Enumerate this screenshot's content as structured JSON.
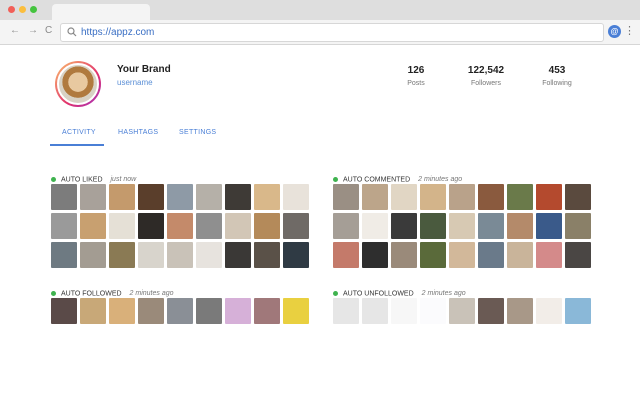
{
  "browser": {
    "url": "https://appz.com",
    "traffic_lights": [
      "#f25f58",
      "#fbbe3d",
      "#45c43f"
    ],
    "back_glyph": "←",
    "forward_glyph": "→",
    "reload_glyph": "C",
    "extension_badge": "@",
    "menu_glyph": "⋮"
  },
  "profile": {
    "brand": "Your Brand",
    "username": "username",
    "stats": [
      {
        "value": "126",
        "label": "Posts"
      },
      {
        "value": "122,542",
        "label": "Followers"
      },
      {
        "value": "453",
        "label": "Following"
      }
    ]
  },
  "tabs": [
    {
      "label": "ACTIVITY",
      "active": true
    },
    {
      "label": "HASHTAGS",
      "active": false
    },
    {
      "label": "SETTINGS",
      "active": false
    }
  ],
  "sections": {
    "auto_liked": {
      "title": "AUTO LIKED",
      "time": "just now",
      "thumbs": [
        "#7c7c7c",
        "#a8a19a",
        "#c49a6c",
        "#5a3e2b",
        "#8e9aa6",
        "#b5b0a8",
        "#3e3a36",
        "#d9b88a",
        "#e8e2da",
        "#9a9a9a",
        "#c8a070",
        "#e5e0d6",
        "#2e2a27",
        "#c48a6a",
        "#8f8f8f",
        "#d2c6b6",
        "#b48a5a",
        "#6f6a66",
        "#6e7a82",
        "#a39c92",
        "#8a7a54",
        "#d8d4cc",
        "#c9c2b8",
        "#e7e3de",
        "#3a3836",
        "#5a5148",
        "#2f3a44"
      ]
    },
    "auto_commented": {
      "title": "AUTO COMMENTED",
      "time": "2 minutes ago",
      "thumbs": [
        "#9a8f84",
        "#bca58a",
        "#e1d6c4",
        "#d3b48a",
        "#b9a28a",
        "#8a5a3e",
        "#6a7a4a",
        "#b44a2e",
        "#5a4a3e",
        "#a59e96",
        "#f0ece6",
        "#3a3a3a",
        "#4a5a3e",
        "#d7c9b3",
        "#7a8a96",
        "#b48a6a",
        "#3a5a8a",
        "#8a8068",
        "#c47a6a",
        "#2e2e2e",
        "#9a8a7a",
        "#5a6a3a",
        "#d2b89a",
        "#6a7a8a",
        "#c9b49a",
        "#d48a8a",
        "#4a4644"
      ]
    },
    "auto_followed": {
      "title": "AUTO FOLLOWED",
      "time": "2 minutes ago",
      "thumbs": [
        "#5a4a48",
        "#c8a878",
        "#d9b07a",
        "#9a8a7a",
        "#8a8f96",
        "#7a7a7a",
        "#d6b0d8",
        "#a0787a",
        "#e9d040"
      ]
    },
    "auto_unfollowed": {
      "title": "AUTO UNFOLLOWED",
      "time": "2 minutes ago",
      "thumbs": [
        "#e6e6e6",
        "#e6e6e6",
        "#f7f7f7",
        "#fbfbfd",
        "#c9c2b8",
        "#6a5a54",
        "#a89888",
        "#f2ede8",
        "#8ab8d8"
      ]
    }
  }
}
